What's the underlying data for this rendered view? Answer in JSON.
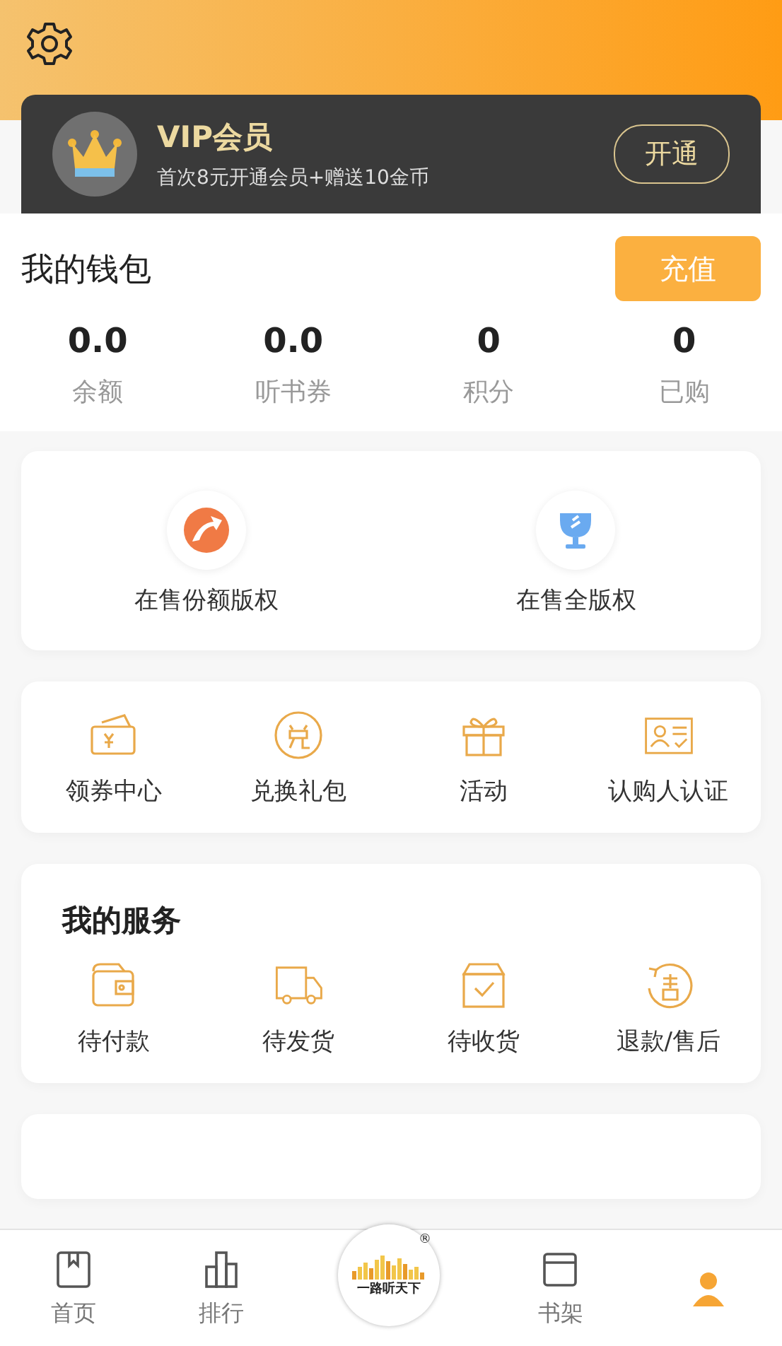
{
  "vip": {
    "title": "VIP会员",
    "subtitle": "首次8元开通会员+赠送10金币",
    "button": "开通"
  },
  "wallet": {
    "title": "我的钱包",
    "button": "充值",
    "stats": [
      {
        "value": "0.0",
        "label": "余额"
      },
      {
        "value": "0.0",
        "label": "听书券"
      },
      {
        "value": "0",
        "label": "积分"
      },
      {
        "value": "0",
        "label": "已购"
      }
    ]
  },
  "copyright": [
    {
      "kind": "share",
      "label": "在售份额版权"
    },
    {
      "kind": "trophy",
      "label": "在售全版权"
    }
  ],
  "shortcuts": [
    {
      "kind": "coupon",
      "label": "领券中心"
    },
    {
      "kind": "exchange",
      "label": "兑换礼包"
    },
    {
      "kind": "gift",
      "label": "活动"
    },
    {
      "kind": "idcard",
      "label": "认购人认证"
    }
  ],
  "services": {
    "title": "我的服务",
    "items": [
      {
        "kind": "wallet",
        "label": "待付款"
      },
      {
        "kind": "truck",
        "label": "待发货"
      },
      {
        "kind": "box",
        "label": "待收货"
      },
      {
        "kind": "refund",
        "label": "退款/售后"
      }
    ]
  },
  "logo": {
    "text": "一路听天下",
    "mark": "®"
  },
  "nav": [
    {
      "kind": "home",
      "label": "首页",
      "selected": false
    },
    {
      "kind": "rank",
      "label": "排行",
      "selected": false
    },
    {
      "kind": "shelf",
      "label": "书架",
      "selected": false
    },
    {
      "kind": "me",
      "selected": true
    }
  ]
}
